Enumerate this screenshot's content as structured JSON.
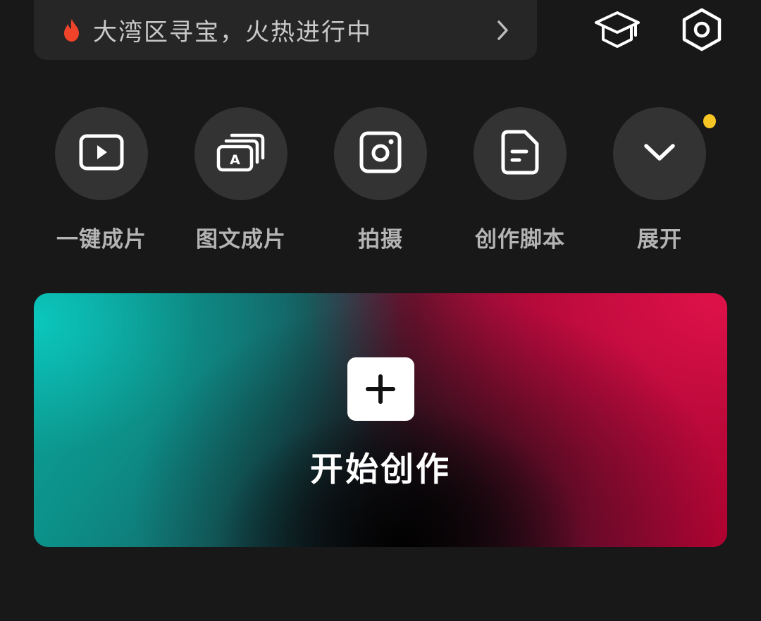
{
  "header": {
    "search_banner_text": "大湾区寻宝，火热进行中",
    "fire_icon": "fire-icon",
    "chevron_icon": "chevron-right-icon",
    "academy_icon": "graduation-cap-icon",
    "settings_icon": "settings-hexagon-icon"
  },
  "quick_actions": [
    {
      "label": "一键成片",
      "icon": "play-video-icon"
    },
    {
      "label": "图文成片",
      "icon": "text-to-video-icon"
    },
    {
      "label": "拍摄",
      "icon": "camera-icon"
    },
    {
      "label": "创作脚本",
      "icon": "script-document-icon"
    },
    {
      "label": "展开",
      "icon": "chevron-down-icon",
      "badge": true
    }
  ],
  "create_card": {
    "label": "开始创作",
    "icon": "plus-icon"
  },
  "colors": {
    "background": "#181818",
    "surface": "#262626",
    "circle": "#333333",
    "label": "#b4b4b4",
    "fire": "#f0432a",
    "badge": "#f7c624",
    "gradient_left": "#0bc7bd",
    "gradient_right": "#e0124a"
  }
}
